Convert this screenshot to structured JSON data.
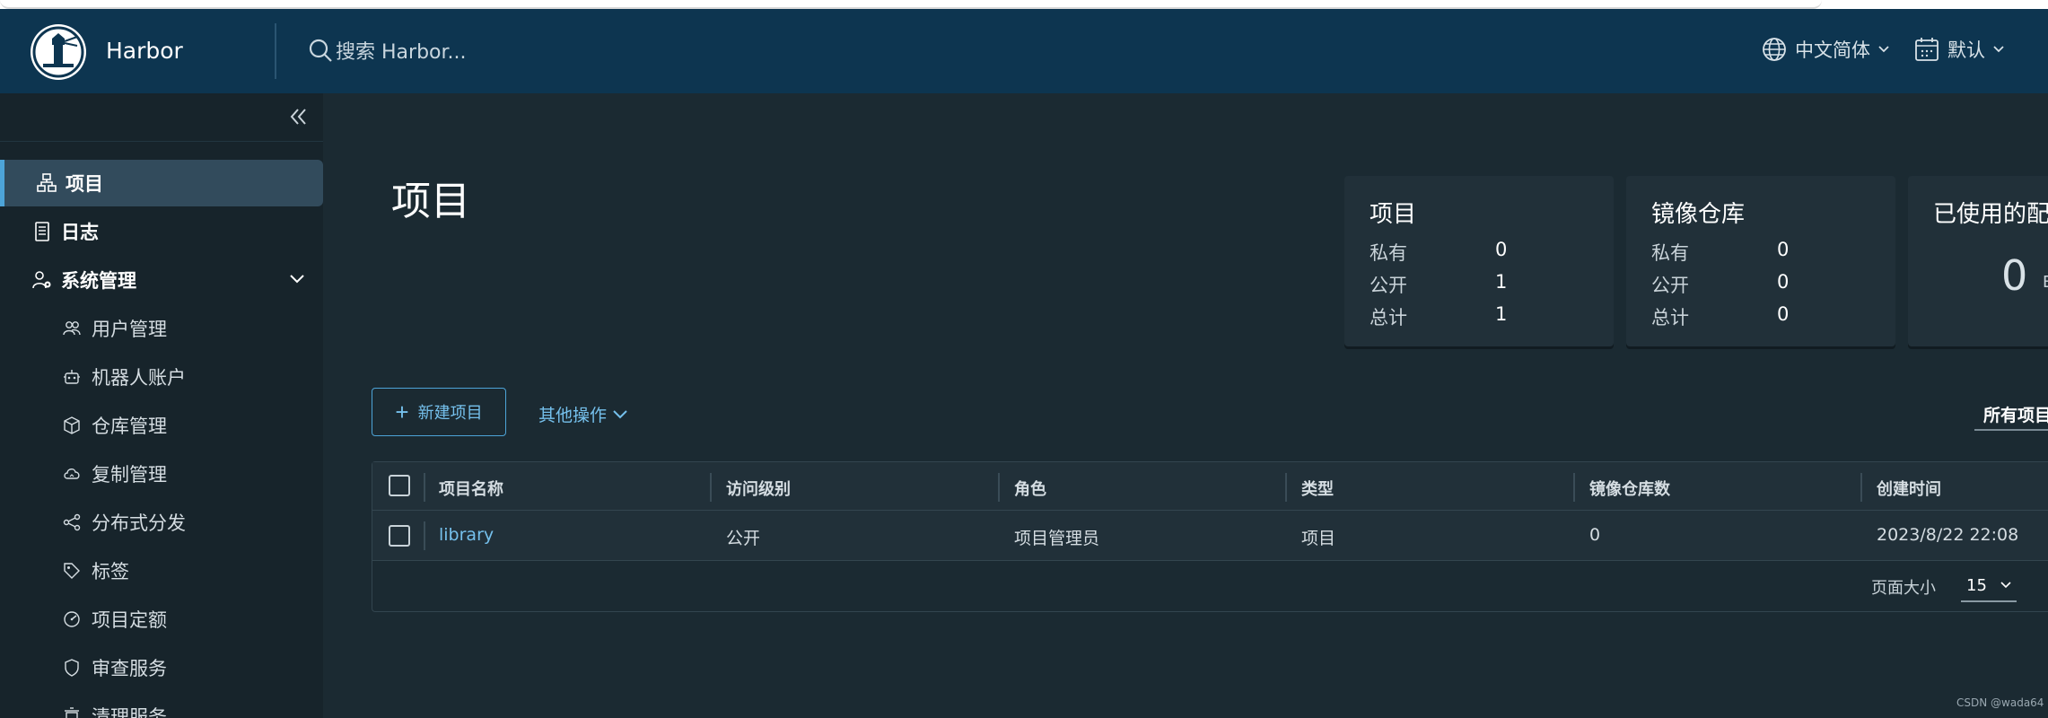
{
  "header": {
    "brand": "Harbor",
    "search_placeholder": "搜索 Harbor...",
    "language": "中文简体",
    "user": "默认"
  },
  "sidebar": {
    "items": [
      {
        "label": "项目",
        "icon": "projects-icon",
        "active": true
      },
      {
        "label": "日志",
        "icon": "logs-icon"
      },
      {
        "label": "系统管理",
        "icon": "admin-icon",
        "expanded": true
      }
    ],
    "sub_items": [
      {
        "label": "用户管理",
        "icon": "users-icon"
      },
      {
        "label": "机器人账户",
        "icon": "robot-icon"
      },
      {
        "label": "仓库管理",
        "icon": "registry-icon"
      },
      {
        "label": "复制管理",
        "icon": "replication-icon"
      },
      {
        "label": "分布式分发",
        "icon": "distribution-icon"
      },
      {
        "label": "标签",
        "icon": "tag-icon"
      },
      {
        "label": "项目定额",
        "icon": "quota-icon"
      },
      {
        "label": "审查服务",
        "icon": "shield-icon"
      },
      {
        "label": "清理服务",
        "icon": "cleanup-icon"
      }
    ]
  },
  "main": {
    "title": "项目",
    "cards": [
      {
        "title": "项目",
        "rows": [
          {
            "label": "私有",
            "value": "0"
          },
          {
            "label": "公开",
            "value": "1"
          },
          {
            "label": "总计",
            "value": "1"
          }
        ]
      },
      {
        "title": "镜像仓库",
        "rows": [
          {
            "label": "私有",
            "value": "0"
          },
          {
            "label": "公开",
            "value": "0"
          },
          {
            "label": "总计",
            "value": "0"
          }
        ]
      },
      {
        "title": "已使用的配",
        "value": "0",
        "unit": "B"
      }
    ],
    "new_project_label": "新建项目",
    "other_ops_label": "其他操作",
    "filter_label": "所有项目"
  },
  "table": {
    "columns": [
      "项目名称",
      "访问级别",
      "角色",
      "类型",
      "镜像仓库数",
      "创建时间"
    ],
    "rows": [
      [
        "library",
        "公开",
        "项目管理员",
        "项目",
        "0",
        "2023/8/22 22:08"
      ]
    ],
    "page_size_label": "页面大小",
    "page_size": "15"
  },
  "watermark": "CSDN @wada64",
  "colors": {
    "header_bg": "#0d3550",
    "sidebar_bg": "#17242b",
    "main_bg": "#1b2a32",
    "accent": "#4da4d8",
    "link": "#75c0ec"
  }
}
